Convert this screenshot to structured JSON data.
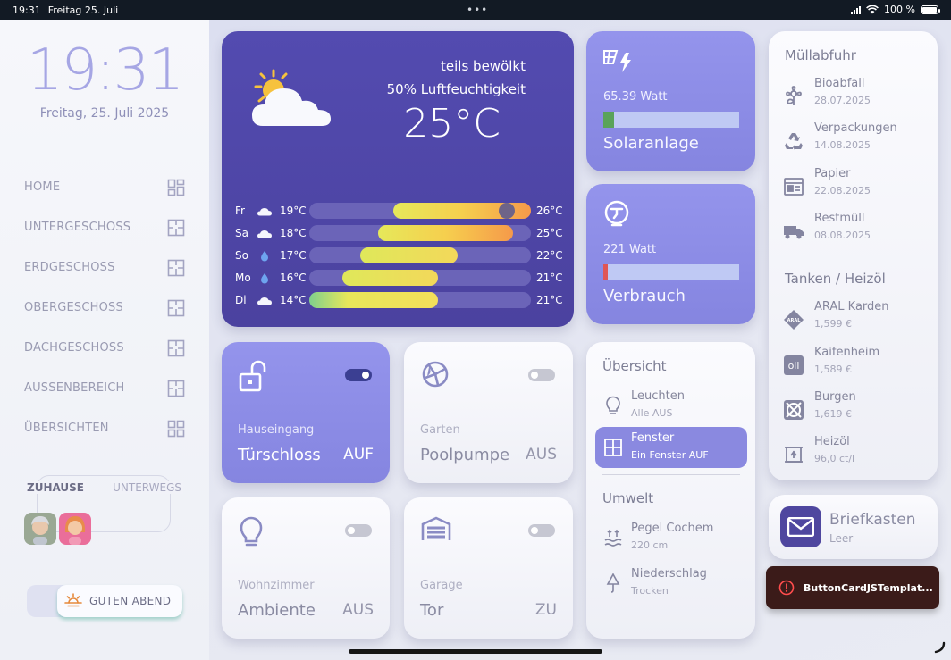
{
  "status": {
    "time": "19:31",
    "date": "Freitag 25. Juli",
    "battery": "100 %",
    "battery_level": 1.0
  },
  "sidebar": {
    "clock": "19:31",
    "date": "Freitag, 25. Juli 2025",
    "nav": [
      {
        "label": "HOME",
        "icon": "dashboard-icon"
      },
      {
        "label": "UNTERGESCHOSS",
        "icon": "floorplan-icon"
      },
      {
        "label": "ERDGESCHOSS",
        "icon": "floorplan-icon"
      },
      {
        "label": "OBERGESCHOSS",
        "icon": "floorplan-icon"
      },
      {
        "label": "DACHGESCHOSS",
        "icon": "floorplan-icon"
      },
      {
        "label": "AUSSENBEREICH",
        "icon": "floorplan-icon"
      },
      {
        "label": "ÜBERSICHTEN",
        "icon": "dashboard-icon"
      }
    ],
    "presence": {
      "home_label": "ZUHAUSE",
      "away_label": "UNTERWEGS"
    },
    "scene_button": "GUTEN ABEND"
  },
  "weather": {
    "condition": "teils bewölkt",
    "humidity": "50% Luftfeuchtigkeit",
    "temperature": "25°C",
    "forecast": [
      {
        "day": "Fr",
        "icon": "cloud",
        "low": "19°C",
        "high": "26°C",
        "bar_from": 0.38,
        "bar_to": 1.0,
        "marker": 0.89
      },
      {
        "day": "Sa",
        "icon": "cloud",
        "low": "18°C",
        "high": "25°C",
        "bar_from": 0.31,
        "bar_to": 0.92
      },
      {
        "day": "So",
        "icon": "drop",
        "low": "17°C",
        "high": "22°C",
        "bar_from": 0.23,
        "bar_to": 0.67
      },
      {
        "day": "Mo",
        "icon": "drop",
        "low": "16°C",
        "high": "21°C",
        "bar_from": 0.15,
        "bar_to": 0.58
      },
      {
        "day": "Di",
        "icon": "cloud",
        "low": "14°C",
        "high": "21°C",
        "bar_from": 0.0,
        "bar_to": 0.58
      }
    ]
  },
  "solar": {
    "watt": "65.39 Watt",
    "label": "Solaranlage",
    "level": 0.08,
    "level_color": "#5aa35a"
  },
  "consumption": {
    "watt": "221 Watt",
    "label": "Verbrauch",
    "level": 0.03,
    "level_color": "#e05555"
  },
  "tiles": {
    "door": {
      "room": "Hauseingang",
      "name": "Türschloss",
      "state": "AUF"
    },
    "pool": {
      "room": "Garten",
      "name": "Poolpumpe",
      "state": "AUS"
    },
    "ambient": {
      "room": "Wohnzimmer",
      "name": "Ambiente",
      "state": "AUS"
    },
    "garage": {
      "room": "Garage",
      "name": "Tor",
      "state": "ZU"
    }
  },
  "overview": {
    "title": "Übersicht",
    "lights": {
      "title": "Leuchten",
      "sub": "Alle AUS"
    },
    "windows": {
      "title": "Fenster",
      "sub": "Ein Fenster AUF"
    },
    "env_title": "Umwelt",
    "level": {
      "title": "Pegel Cochem",
      "sub": "220 cm"
    },
    "rain": {
      "title": "Niederschlag",
      "sub": "Trocken"
    }
  },
  "waste": {
    "title": "Müllabfuhr",
    "items": [
      {
        "title": "Bioabfall",
        "sub": "28.07.2025"
      },
      {
        "title": "Verpackungen",
        "sub": "14.08.2025"
      },
      {
        "title": "Papier",
        "sub": "22.08.2025"
      },
      {
        "title": "Restmüll",
        "sub": "08.08.2025"
      }
    ],
    "fuel_title": "Tanken / Heizöl",
    "fuel": [
      {
        "title": "ARAL Karden",
        "sub": "1,599 €",
        "badge": "ARAL"
      },
      {
        "title": "Kaifenheim",
        "sub": "1,589 €",
        "badge": "oil"
      },
      {
        "title": "Burgen",
        "sub": "1,619 €"
      },
      {
        "title": "Heizöl",
        "sub": "96,0 ct/l"
      }
    ]
  },
  "mailbox": {
    "title": "Briefkasten",
    "sub": "Leer"
  },
  "toast": {
    "text": "ButtonCardJSTemplat..."
  },
  "colors": {
    "accent": "#8a89e0",
    "weather_bg": "#4f469f",
    "error": "#3b1b19"
  }
}
